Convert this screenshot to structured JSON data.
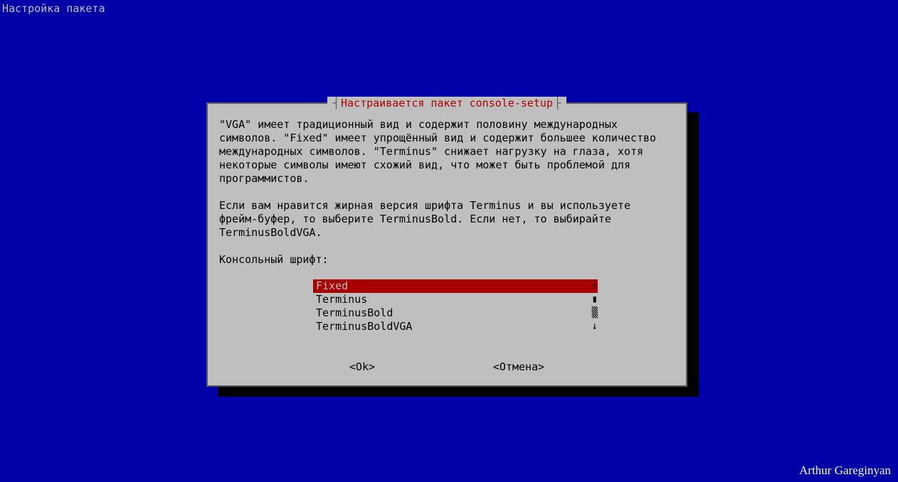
{
  "top_title": "Настройка пакета",
  "dialog": {
    "title": "Настраивается пакет console-setup",
    "paragraph1": "\"VGA\" имеет традиционный вид и содержит половину международных символов. \"Fixed\" имеет упрощённый вид и содержит большее количество международных символов. \"Terminus\" снижает нагрузку на глаза, хотя некоторые символы имеют схожий вид, что может быть проблемой для программистов.",
    "paragraph2": "Если вам нравится жирная версия шрифта Terminus и вы используете фрейм-буфер, то выберите TerminusBold. Если нет, то выбирайте TerminusBoldVGA.",
    "prompt": "Консольный шрифт:",
    "options": [
      {
        "label": "Fixed",
        "selected": true
      },
      {
        "label": "Terminus",
        "selected": false
      },
      {
        "label": "TerminusBold",
        "selected": false
      },
      {
        "label": "TerminusBoldVGA",
        "selected": false
      }
    ],
    "scroll": {
      "up": "↑",
      "thumb1": "▮",
      "thumb2": "▒",
      "down": "↓"
    },
    "ok_label": "<Ok>",
    "cancel_label": "<Отмена>"
  },
  "watermark": "Arthur Gareginyan"
}
